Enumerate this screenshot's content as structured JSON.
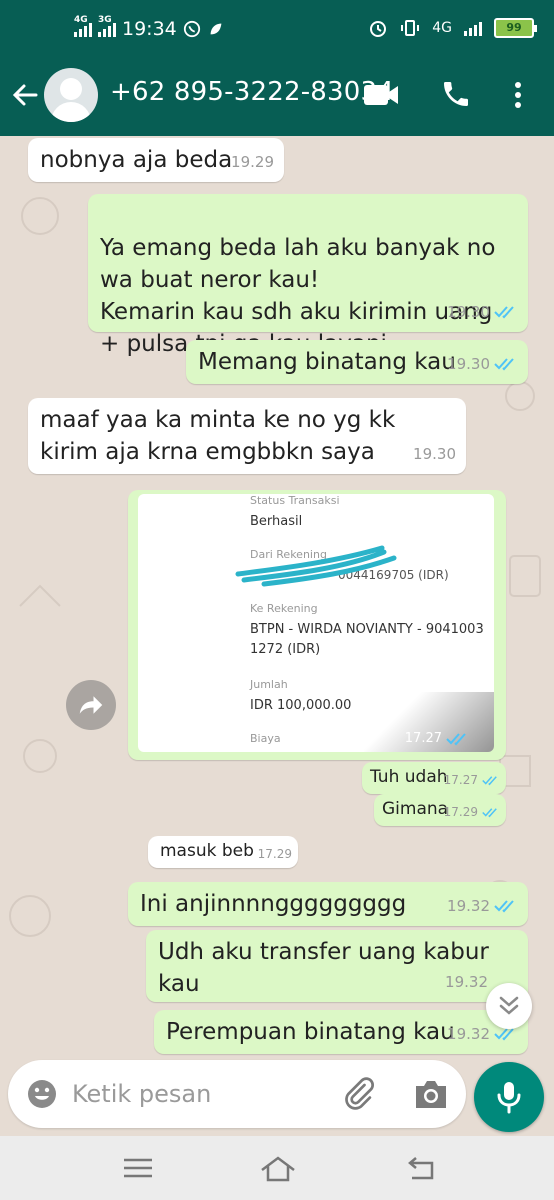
{
  "status_bar": {
    "time": "19:34",
    "net1": "4G",
    "net2": "3G",
    "net3": "4G",
    "battery": "99"
  },
  "header": {
    "contact": "+62 895-3222-83034"
  },
  "messages": [
    {
      "dir": "in",
      "text": "nobnya aja beda",
      "time": "19.29"
    },
    {
      "dir": "out",
      "text": "Ya emang beda lah aku banyak no wa buat neror kau!\nKemarin kau sdh aku kirimin uang + pulsa tpi ga kau layani",
      "time": "19.30"
    },
    {
      "dir": "out",
      "text": "Memang binatang kau",
      "time": "19.30"
    },
    {
      "dir": "in",
      "text": "maaf yaa ka minta ke no yg kk kirim aja krna emgbbkn saya",
      "time": "19.30"
    },
    {
      "dir": "out",
      "text": "Tuh udah",
      "time": "17.27"
    },
    {
      "dir": "out",
      "text": "Gimana",
      "time": "17.29"
    },
    {
      "dir": "in",
      "text": "masuk beb",
      "time": "17.29"
    },
    {
      "dir": "out",
      "text": "Ini anjinnnnggggggggg",
      "time": "19.32"
    },
    {
      "dir": "out",
      "text": "Udh aku transfer uang kabur kau",
      "time": "19.32"
    },
    {
      "dir": "out",
      "text": "Perempuan binatang kau",
      "time": "19.32"
    }
  ],
  "receipt": {
    "status_label": "Status Transaksi",
    "status_value": "Berhasil",
    "from_label": "Dari Rekening",
    "from_value": "0044169705 (IDR)",
    "to_label": "Ke Rekening",
    "to_line1": "BTPN - WIRDA NOVIANTY - 9041003",
    "to_line2": "1272 (IDR)",
    "amount_label": "Jumlah",
    "amount_value": "IDR 100,000.00",
    "fee_label": "Biaya",
    "time": "17.27"
  },
  "input": {
    "placeholder": "Ketik pesan"
  },
  "colors": {
    "header": "#075e54",
    "outgoing_bubble": "#dcf8c6",
    "read_tick": "#4fc3f7",
    "mic_button": "#00897b"
  },
  "icons": [
    "back-arrow-icon",
    "avatar-icon",
    "video-call-icon",
    "phone-icon",
    "more-vert-icon",
    "forward-icon",
    "scroll-down-icon",
    "emoji-icon",
    "attach-icon",
    "camera-icon",
    "mic-icon",
    "menu-icon",
    "home-icon",
    "back-nav-icon"
  ]
}
